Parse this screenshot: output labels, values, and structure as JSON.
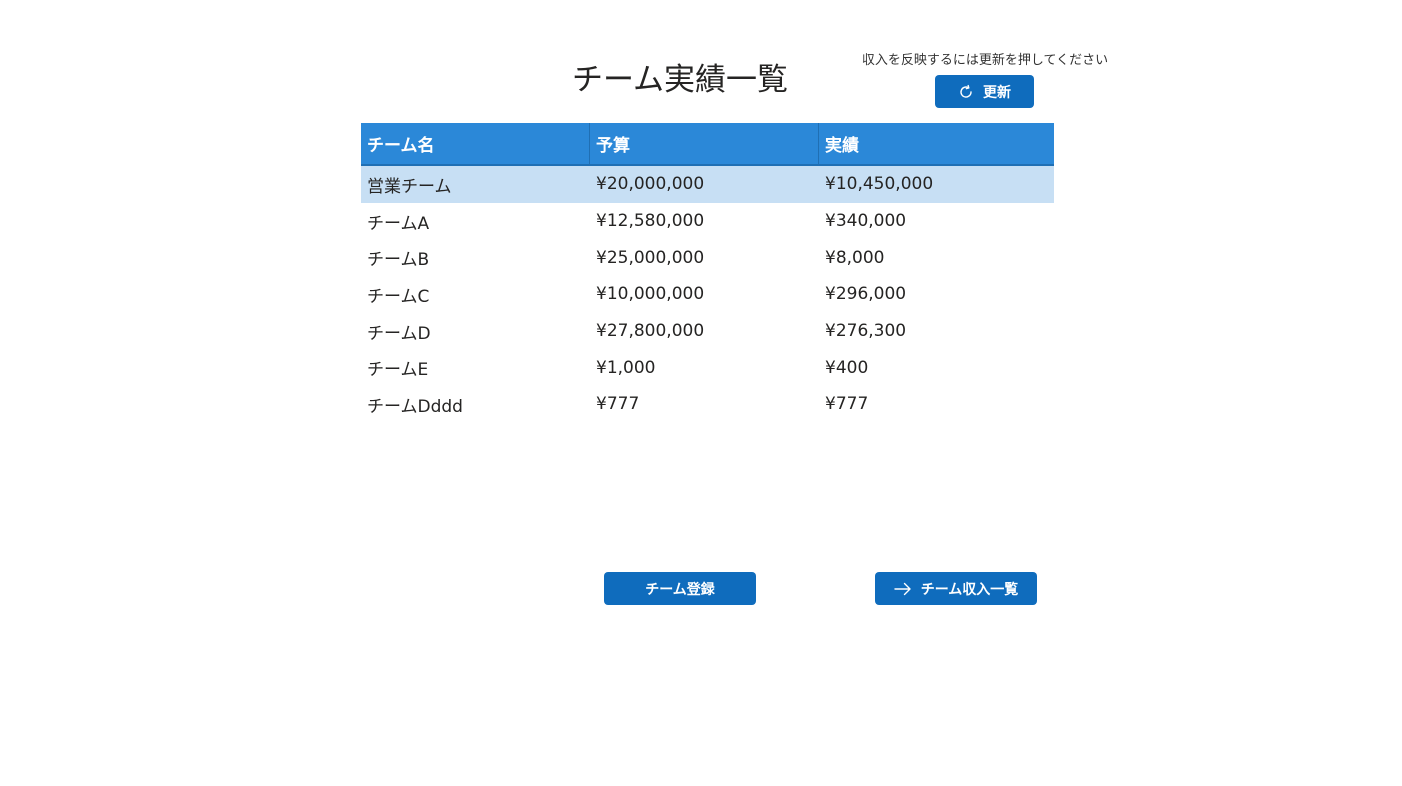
{
  "page_title": "チーム実績一覧",
  "refresh": {
    "hint": "収入を反映するには更新を押してください",
    "label": "更新",
    "icon": "refresh-icon"
  },
  "table": {
    "columns": [
      "チーム名",
      "予算",
      "実績"
    ],
    "rows": [
      {
        "name": "営業チーム",
        "budget": "¥20,000,000",
        "actual": "¥10,450,000",
        "selected": true
      },
      {
        "name": "チームA",
        "budget": "¥12,580,000",
        "actual": "¥340,000"
      },
      {
        "name": "チームB",
        "budget": "¥25,000,000",
        "actual": "¥8,000"
      },
      {
        "name": "チームC",
        "budget": "¥10,000,000",
        "actual": "¥296,000"
      },
      {
        "name": "チームD",
        "budget": "¥27,800,000",
        "actual": "¥276,300"
      },
      {
        "name": "チームE",
        "budget": "¥1,000",
        "actual": "¥400"
      },
      {
        "name": "チームDddd",
        "budget": "¥777",
        "actual": "¥777"
      }
    ]
  },
  "actions": {
    "register_label": "チーム登録",
    "income_list_label": "チーム収入一覧",
    "income_list_icon": "arrow-right-icon"
  },
  "colors": {
    "accent": "#0f6cbd",
    "header_bg": "#2b88d8",
    "selected_row_bg": "#c7dff4"
  }
}
